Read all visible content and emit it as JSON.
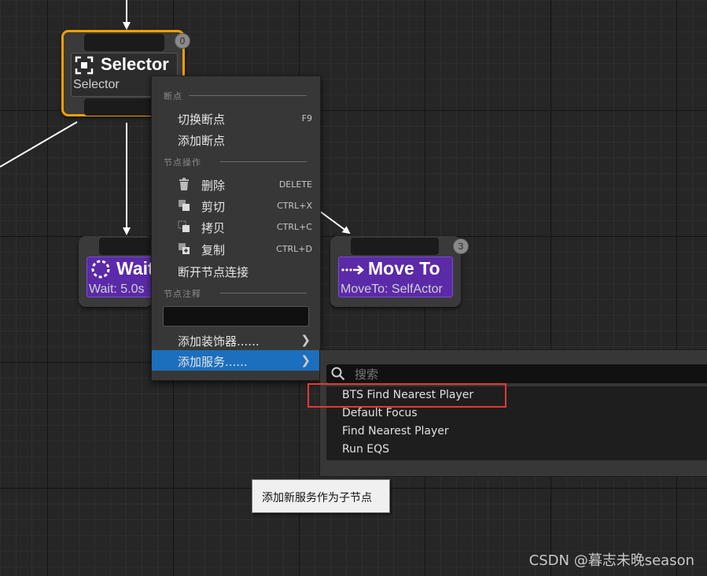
{
  "nodes": {
    "selector": {
      "title": "Selector",
      "subtitle": "Selector",
      "badge": "0"
    },
    "wait": {
      "title": "Wait",
      "subtitle": "Wait: 5.0s"
    },
    "move_to": {
      "title": "Move To",
      "subtitle": "MoveTo: SelfActor",
      "badge": "3"
    }
  },
  "context_menu": {
    "sections": {
      "breakpoints": "断点",
      "node_actions": "节点操作",
      "node_comment": "节点注释"
    },
    "items": {
      "toggle_breakpoint": {
        "label": "切换断点",
        "shortcut": "F9"
      },
      "add_breakpoint": {
        "label": "添加断点"
      },
      "delete": {
        "label": "删除",
        "shortcut": "DELETE"
      },
      "cut": {
        "label": "剪切",
        "shortcut": "CTRL+X"
      },
      "copy": {
        "label": "拷贝",
        "shortcut": "CTRL+C"
      },
      "duplicate": {
        "label": "复制",
        "shortcut": "CTRL+D"
      },
      "break_links": {
        "label": "断开节点连接"
      },
      "add_decorator": {
        "label": "添加装饰器......"
      },
      "add_service": {
        "label": "添加服务......"
      }
    },
    "comment_value": ""
  },
  "submenu": {
    "search_placeholder": "搜索",
    "items": [
      "BTS Find Nearest Player",
      "Default Focus",
      "Find Nearest Player",
      "Run EQS"
    ]
  },
  "tooltip": "添加新服务作为子节点",
  "watermark": "CSDN @暮志未晚season",
  "colors": {
    "selected_outline": "#f0a000",
    "task_purple": "#5b2aa8",
    "highlight": "#1c6fbd",
    "annotation_red": "#e53935"
  }
}
